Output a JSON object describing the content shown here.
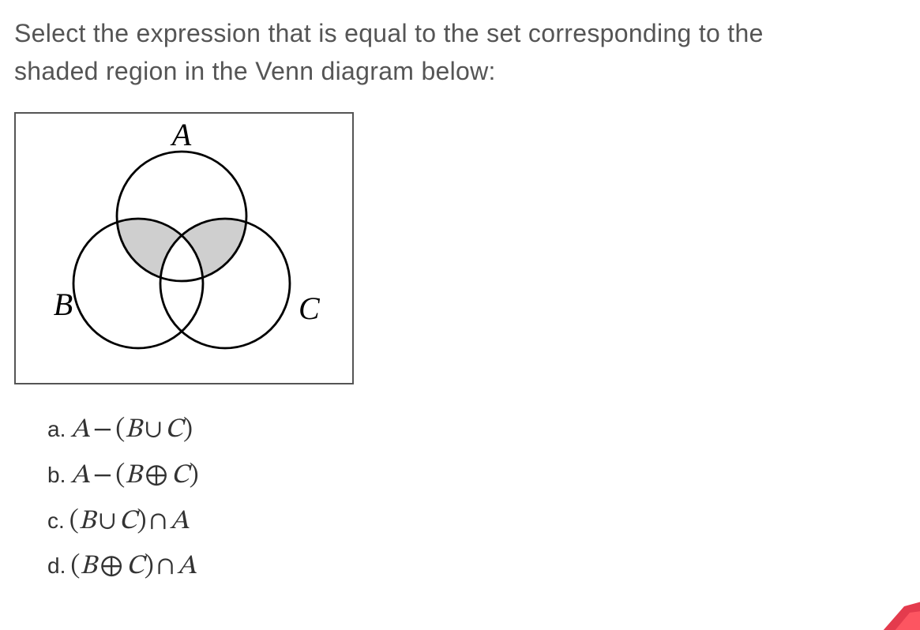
{
  "question": {
    "prompt_line1": "Select the expression that is equal to the set corresponding to the",
    "prompt_line2": "shaded region in the Venn diagram below:"
  },
  "venn": {
    "label_top": "A",
    "label_left": "B",
    "label_right": "C"
  },
  "options": {
    "a": {
      "letter": "a.",
      "var1": "A",
      "op1": "−",
      "lp": "(",
      "var2": "B",
      "op2": "∪",
      "var3": "C",
      "rp": ")"
    },
    "b": {
      "letter": "b.",
      "var1": "A",
      "op1": "−",
      "lp": "(",
      "var2": "B",
      "op2": "⊕",
      "var3": "C",
      "rp": ")"
    },
    "c": {
      "letter": "c.",
      "lp": "(",
      "var1": "B",
      "op1": "∪",
      "var2": "C",
      "rp": ")",
      "op2": "∩",
      "var3": "A"
    },
    "d": {
      "letter": "d.",
      "lp": "(",
      "var1": "B",
      "op1": "⊕",
      "var2": "C",
      "rp": ")",
      "op2": "∩",
      "var3": "A"
    }
  }
}
